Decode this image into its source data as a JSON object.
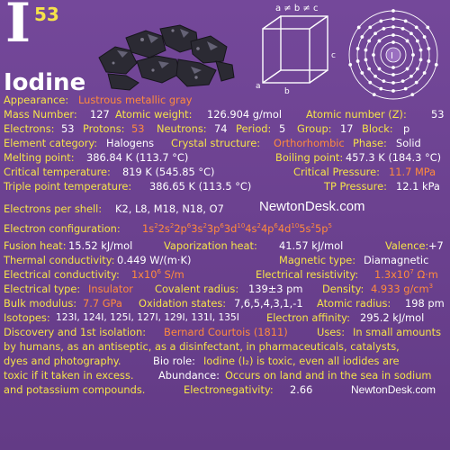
{
  "element": {
    "symbol": "I",
    "atomic_number": "53",
    "name": "Iodine"
  },
  "cube": {
    "constraint": "a ≠ b ≠ c",
    "a": "a",
    "b": "b",
    "c": "c"
  },
  "shell": {
    "center": "I"
  },
  "colors": {
    "background": "#6a3f8c",
    "label": "#f5e24a",
    "highlight": "#ff8a3d",
    "value": "#ffffff"
  },
  "rows": {
    "appearance_label": "Appearance:",
    "appearance_value": "Lustrous metallic gray",
    "mass_number_label": "Mass Number:",
    "mass_number_value": "127",
    "atomic_weight_label": "Atomic weight:",
    "atomic_weight_value": "126.904 g/mol",
    "atomic_number_label": "Atomic number (Z):",
    "atomic_number_value": "53",
    "electrons_label": "Electrons:",
    "electrons_value": "53",
    "protons_label": "Protons:",
    "protons_value": "53",
    "neutrons_label": "Neutrons:",
    "neutrons_value": "74",
    "period_label": "Period:",
    "period_value": "5",
    "group_label": "Group:",
    "group_value": "17",
    "block_label": "Block:",
    "block_value": "p",
    "category_label": "Element category:",
    "category_value": "Halogens",
    "crystal_label": "Crystal structure:",
    "crystal_value": "Orthorhombic",
    "phase_label": "Phase:",
    "phase_value": "Solid",
    "melting_label": "Melting point:",
    "melting_value": "386.84 K (113.7 °C)",
    "boiling_label": "Boiling point:",
    "boiling_value": "457.3 K (184.3 °C)",
    "crit_temp_label": "Critical temperature:",
    "crit_temp_value": "819 K (545.85 °C)",
    "crit_press_label": "Critical Pressure:",
    "crit_press_value": "11.7 MPa",
    "triple_label": "Triple point temperature:",
    "triple_value": "386.65 K (113.5 °C)",
    "tp_press_label": "TP Pressure:",
    "tp_press_value": "12.1 kPa",
    "shell_label": "Electrons per shell:",
    "shell_value": "K2, L8, M18, N18, O7",
    "watermark": "NewtonDesk.com",
    "config_label": "Electron configuration:",
    "fusion_label": "Fusion heat:",
    "fusion_value": "15.52 kJ/mol",
    "vapor_label": "Vaporization heat:",
    "vapor_value": "41.57 kJ/mol",
    "valence_label": "Valence:",
    "valence_value": "+7",
    "thermal_label": "Thermal conductivity:",
    "thermal_value": "0.449 W/(m·K)",
    "magnetic_label": "Magnetic type:",
    "magnetic_value": "Diamagnetic",
    "elec_cond_label": "Electrical conductivity:",
    "elec_res_label": "Electrical resistivity:",
    "elec_type_label": "Electrical type:",
    "elec_type_value": "Insulator",
    "cov_radius_label": "Covalent radius:",
    "cov_radius_value": "139±3 pm",
    "density_label": "Density:",
    "bulk_label": "Bulk modulus:",
    "bulk_value": "7.7 GPa",
    "oxidation_label": "Oxidation states:",
    "oxidation_value": "7,6,5,4,3,1,-1",
    "atomic_radius_label": "Atomic radius:",
    "atomic_radius_value": "198 pm",
    "isotopes_label": "Isotopes:",
    "isotopes_value": "123I, 124I, 125I, 127I, 129I, 131I, 135I",
    "affinity_label": "Electron affinity:",
    "affinity_value": "295.2 kJ/mol",
    "discovery_label": "Discovery and 1st isolation:",
    "discovery_value": "Bernard Courtois (1811)",
    "uses_label": "Uses:",
    "uses_value_1": "In small amounts",
    "uses_value_2": "by humans, as an antiseptic, as a disinfectant, in pharmaceuticals, catalysts,",
    "uses_value_3": "dyes and photography.",
    "bio_label": "Bio role:",
    "bio_value_1": "Iodine (I₂) is toxic, even all iodides are",
    "bio_value_2": "toxic if it taken in excess.",
    "abundance_label": "Abundance:",
    "abundance_value_1": "Occurs on land and in the sea in sodium",
    "abundance_value_2": "and potassium compounds.",
    "electroneg_label": "Electronegativity:",
    "electroneg_value": "2.66",
    "watermark_small": "NewtonDesk.com"
  }
}
